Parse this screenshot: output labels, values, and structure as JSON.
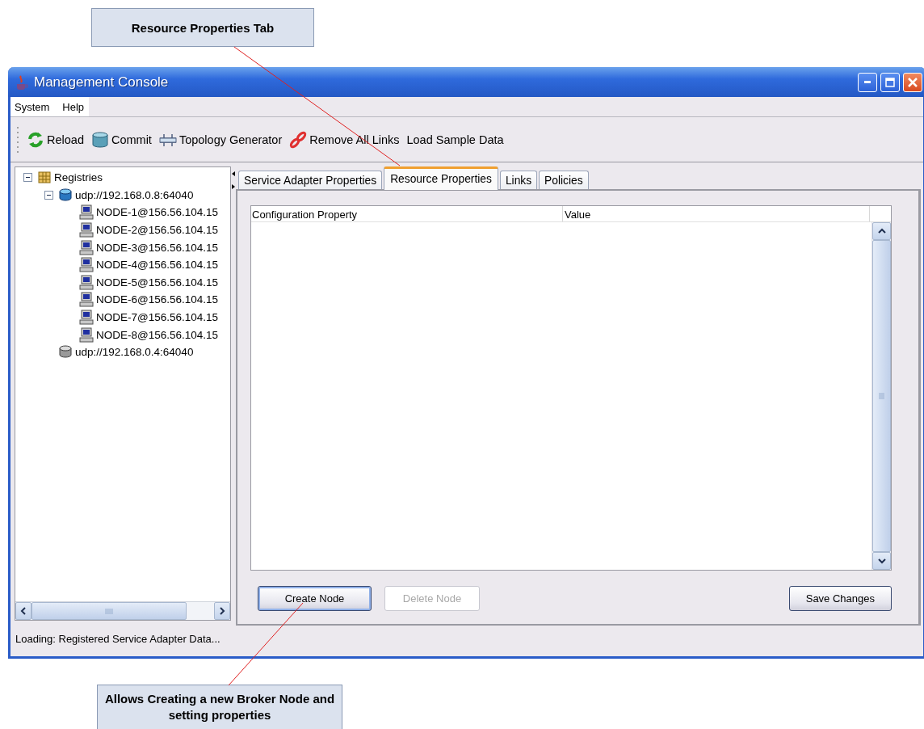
{
  "callouts": [
    {
      "text": "Resource Properties Tab"
    },
    {
      "text": "Allows Creating a new Broker Node and setting properties"
    }
  ],
  "window": {
    "title": "Management Console"
  },
  "menu": [
    "System",
    "Help"
  ],
  "toolbar": [
    {
      "kind": "reload",
      "label": "Reload"
    },
    {
      "kind": "commit",
      "label": "Commit"
    },
    {
      "kind": "topology",
      "label": "Topology Generator"
    },
    {
      "kind": "unlink",
      "label": "Remove All Links"
    },
    {
      "kind": "plain",
      "label": "Load Sample Data"
    }
  ],
  "tree": [
    {
      "label": "Registries",
      "kind": "group",
      "expanded": true,
      "children": [
        {
          "label": "udp://192.168.0.8:64040",
          "kind": "registry",
          "expanded": true,
          "children": [
            {
              "label": "NODE-1@156.56.104.15",
              "kind": "node"
            },
            {
              "label": "NODE-2@156.56.104.15",
              "kind": "node"
            },
            {
              "label": "NODE-3@156.56.104.15",
              "kind": "node"
            },
            {
              "label": "NODE-4@156.56.104.15",
              "kind": "node"
            },
            {
              "label": "NODE-5@156.56.104.15",
              "kind": "node"
            },
            {
              "label": "NODE-6@156.56.104.15",
              "kind": "node"
            },
            {
              "label": "NODE-7@156.56.104.15",
              "kind": "node"
            },
            {
              "label": "NODE-8@156.56.104.15",
              "kind": "node"
            }
          ]
        },
        {
          "label": "udp://192.168.0.4:64040",
          "kind": "registry_idle"
        }
      ]
    }
  ],
  "tabs": [
    {
      "label": "Service Adapter Properties",
      "selected": false
    },
    {
      "label": "Resource Properties",
      "selected": true
    },
    {
      "label": "Links",
      "selected": false
    },
    {
      "label": "Policies",
      "selected": false
    }
  ],
  "table": {
    "columns": [
      "Configuration Property",
      "Value"
    ]
  },
  "buttons": [
    {
      "label": "Create Node",
      "disabled": false,
      "focused": true
    },
    {
      "label": "Delete Node",
      "disabled": true,
      "focused": false
    },
    {
      "label": "Save Changes",
      "disabled": false,
      "focused": false
    }
  ],
  "status_bar": "Loading: Registered Service Adapter Data..."
}
